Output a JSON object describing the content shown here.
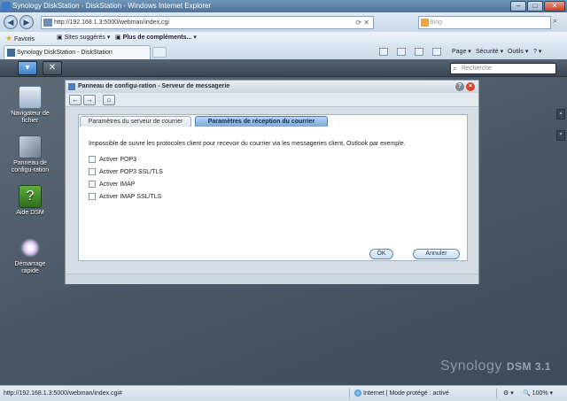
{
  "browser": {
    "title": "Synology DiskStation - DiskStation - Windows Internet Explorer",
    "url": "http://192.168.1.3:5000/webman/index.cgi",
    "search_placeholder": "Bing",
    "favorites": {
      "favoris": "Favoris",
      "sites": "Sites suggérés",
      "plus": "Plus de compléments..."
    },
    "tab_title": "Synology DiskStation - DiskStation",
    "commands": {
      "page": "Page",
      "securite": "Sécurité",
      "outils": "Outils",
      "help": "?"
    }
  },
  "dsm": {
    "search_placeholder": "Recherche",
    "desktop_icons": [
      {
        "label": "Navigateur de fichier",
        "icon": "folder-search-icon"
      },
      {
        "label": "Panneau de configu-ration",
        "icon": "tools-icon"
      },
      {
        "label": "Aide DSM",
        "icon": "help-icon"
      },
      {
        "label": "Démarrage rapide",
        "icon": "magic-wand-icon"
      }
    ],
    "brand": {
      "name": "Synology",
      "product": "DSM 3.1"
    }
  },
  "window": {
    "title": "Panneau de configu-ration - Serveur de messagerie",
    "tabs": [
      {
        "label": "Paramètres du serveur de courrier",
        "active": false
      },
      {
        "label": "Paramètres de réception du courrier",
        "active": true
      }
    ],
    "description": "Impossible de suivre les protocoles client pour recevoir du courrier via les messageries client, Outlook par exemple.",
    "options": [
      {
        "label": "Activer POP3",
        "checked": false
      },
      {
        "label": "Activer POP3 SSL/TLS",
        "checked": false
      },
      {
        "label": "Activer IMAP",
        "checked": false
      },
      {
        "label": "Activer IMAP SSL/TLS",
        "checked": false
      }
    ],
    "ok_label": "OK",
    "cancel_label": "Annuler"
  },
  "status": {
    "url": "http://192.168.1.3:5000/webman/index.cgi#",
    "zone": "Internet | Mode protégé : activé",
    "zoom": "100%"
  }
}
